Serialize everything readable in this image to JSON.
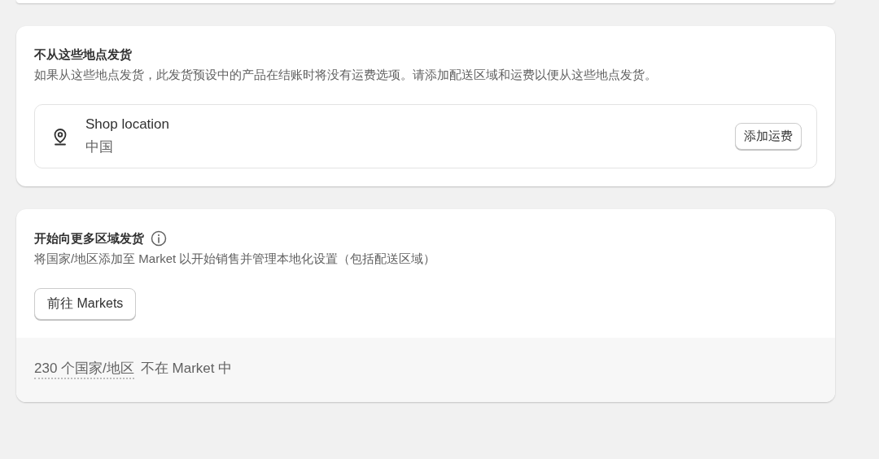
{
  "no_ship_section": {
    "title": "不从这些地点发货",
    "description": "如果从这些地点发货，此发货预设中的产品在结账时将没有运费选项。请添加配送区域和运费以便从这些地点发货。",
    "locations": [
      {
        "name": "Shop location",
        "country": "中国",
        "action": "添加运费"
      }
    ]
  },
  "markets_section": {
    "title": "开始向更多区域发货",
    "description": "将国家/地区添加至 Market 以开始销售并管理本地化设置（包括配送区域）",
    "button": "前往 Markets",
    "footer": {
      "count_link": "230 个国家/地区",
      "text": "不在 Market 中"
    }
  }
}
